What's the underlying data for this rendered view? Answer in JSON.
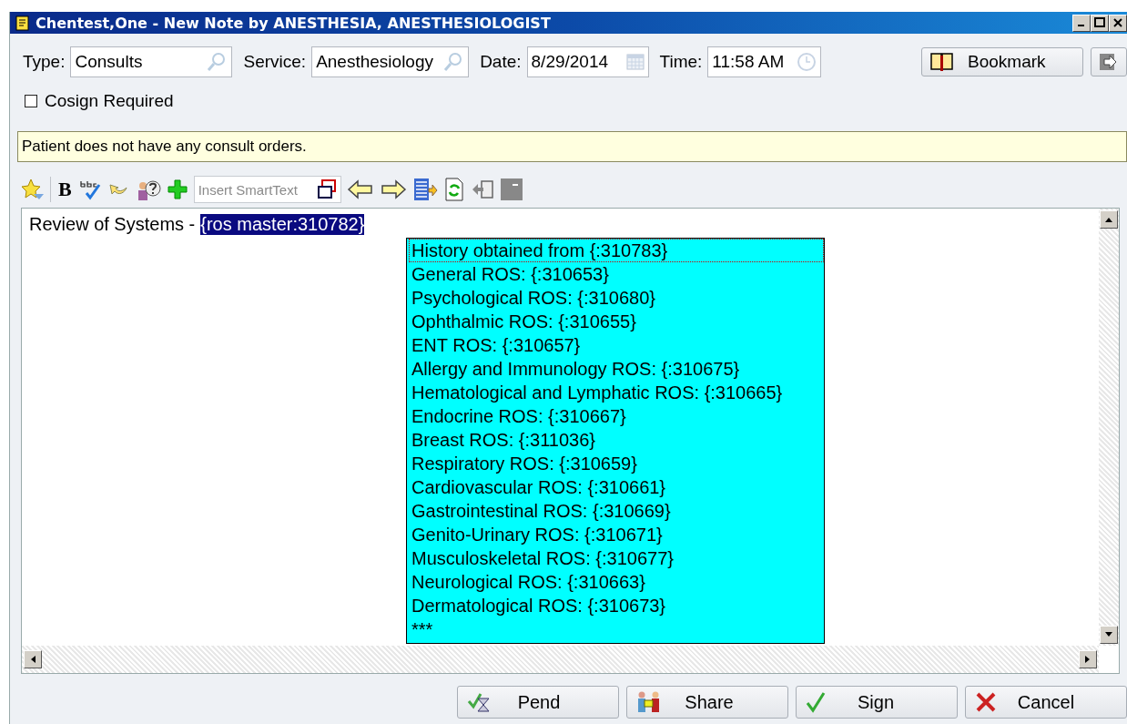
{
  "window": {
    "title": "Chentest,One - New Note by ANESTHESIA, ANESTHESIOLOGIST"
  },
  "header_fields": [
    {
      "label": "Type:",
      "value": "Consults",
      "kind": "lookup"
    },
    {
      "label": "Service:",
      "value": "Anesthesiology",
      "kind": "lookup"
    },
    {
      "label": "Date:",
      "value": "8/29/2014",
      "kind": "date"
    },
    {
      "label": "Time:",
      "value": "11:58 AM",
      "kind": "time"
    }
  ],
  "bookmark_button": {
    "label": "Bookmark"
  },
  "cosign": {
    "label": "Cosign Required",
    "checked": false
  },
  "message_bar": {
    "text": "Patient does not have any consult orders."
  },
  "toolbar": {
    "bold_label": "B",
    "smarttext": {
      "placeholder": "Insert SmartText"
    }
  },
  "editor": {
    "text": "Review of Systems -",
    "selected_token": "{ros master:310782}"
  },
  "smartlist": {
    "items": [
      {
        "label": "History obtained from {:310783}",
        "selected": true
      },
      {
        "label": "General ROS: {:310653}",
        "selected": false
      },
      {
        "label": "Psychological ROS: {:310680}",
        "selected": false
      },
      {
        "label": "Ophthalmic ROS: {:310655}",
        "selected": false
      },
      {
        "label": "ENT ROS: {:310657}",
        "selected": false
      },
      {
        "label": "Allergy and Immunology ROS: {:310675}",
        "selected": false
      },
      {
        "label": "Hematological and Lymphatic ROS: {:310665}",
        "selected": false
      },
      {
        "label": "Endocrine ROS: {:310667}",
        "selected": false
      },
      {
        "label": "Breast ROS: {:311036}",
        "selected": false
      },
      {
        "label": "Respiratory ROS: {:310659}",
        "selected": false
      },
      {
        "label": "Cardiovascular ROS: {:310661}",
        "selected": false
      },
      {
        "label": "Gastrointestinal ROS: {:310669}",
        "selected": false
      },
      {
        "label": "Genito-Urinary ROS: {:310671}",
        "selected": false
      },
      {
        "label": "Musculoskeletal ROS: {:310677}",
        "selected": false
      },
      {
        "label": "Neurological ROS: {:310663}",
        "selected": false
      },
      {
        "label": "Dermatological ROS: {:310673}",
        "selected": false
      },
      {
        "label": "***",
        "selected": false
      }
    ]
  },
  "buttons": [
    {
      "label": "Pend",
      "kind": "pend"
    },
    {
      "label": "Share",
      "kind": "share"
    },
    {
      "label": "Sign",
      "kind": "sign"
    },
    {
      "label": "Cancel",
      "kind": "cancel"
    }
  ]
}
